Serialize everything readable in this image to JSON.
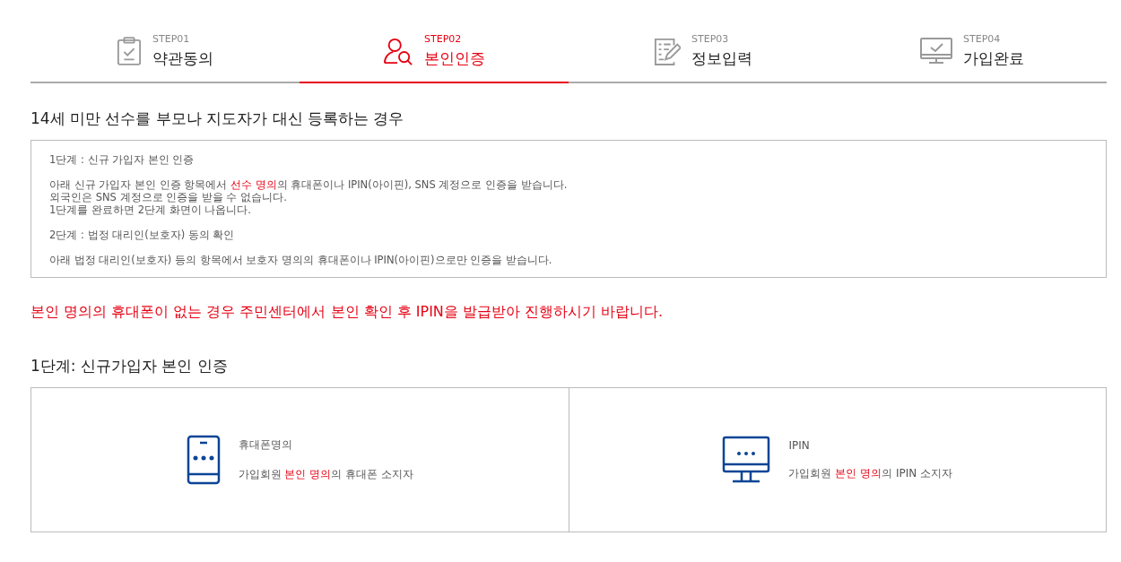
{
  "steps": [
    {
      "step": "STEP01",
      "label": "약관동의",
      "selected": false
    },
    {
      "step": "STEP02",
      "label": "본인인증",
      "selected": true
    },
    {
      "step": "STEP03",
      "label": "정보입력",
      "selected": false
    },
    {
      "step": "STEP04",
      "label": "가입완료",
      "selected": false
    }
  ],
  "section_title": "14세 미만 선수를 부모나 지도자가 대신 등록하는 경우",
  "notice_paragraphs": [
    [
      [
        {
          "text": "1단계 : 신규 가입자 본인 인증",
          "highlight": false
        }
      ]
    ],
    [
      [
        {
          "text": "아래 신규 가입자 본인 인증 항목에서 ",
          "highlight": false
        },
        {
          "text": "선수 명의",
          "highlight": true
        },
        {
          "text": "의 휴대폰이나 IPIN(아이핀), SNS 계정으로 인증을 받습니다.",
          "highlight": false
        }
      ],
      [
        {
          "text": "외국인은 SNS 계정으로 인증을 받을 수 없습니다.",
          "highlight": false
        }
      ],
      [
        {
          "text": "1단계를 완료하면 2단계 화면이 나옵니다.",
          "highlight": false
        }
      ]
    ],
    [
      [
        {
          "text": "2단계 : 법정 대리인(보호자) 동의 확인",
          "highlight": false
        }
      ]
    ],
    [
      [
        {
          "text": "아래 법정 대리인(보호자) 등의 항목에서 보호자 명의의 휴대폰이나 IPIN(아이핀)으로만 인증을 받습니다.",
          "highlight": false
        }
      ]
    ]
  ],
  "warning": "본인 명의의 휴대폰이 없는 경우 주민센터에서 본인 확인 후 IPIN을 발급받아 진행하시기 바랍니다.",
  "step1_title": "1단계: 신규가입자 본인 인증",
  "auth_options": [
    {
      "title": "휴대폰명의",
      "description": [
        {
          "text": "가입회원 ",
          "highlight": false
        },
        {
          "text": "본인 명의",
          "highlight": true
        },
        {
          "text": "의 휴대폰 소지자",
          "highlight": false
        }
      ]
    },
    {
      "title": "IPIN",
      "description": [
        {
          "text": "가입회원 ",
          "highlight": false
        },
        {
          "text": "본인 명의",
          "highlight": true
        },
        {
          "text": "의 IPIN 소지자",
          "highlight": false
        }
      ]
    }
  ]
}
